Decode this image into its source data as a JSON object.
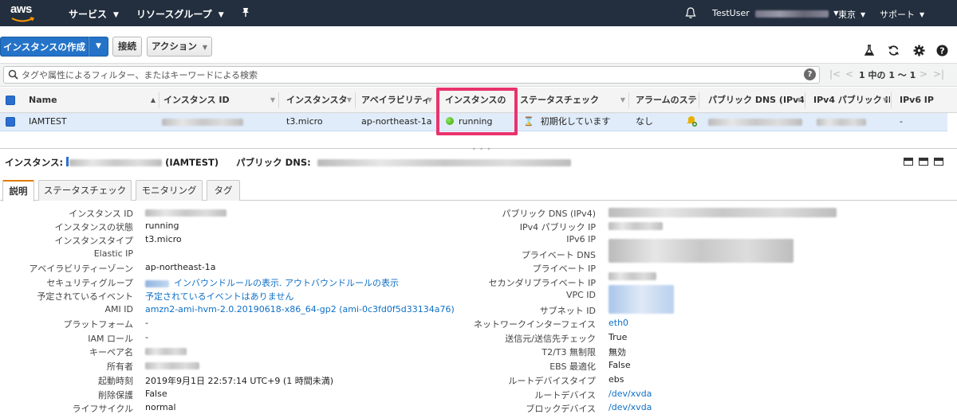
{
  "nav": {
    "logo": "aws",
    "services": "サービス",
    "resource_groups": "リソースグループ",
    "user": "TestUser",
    "region": "東京",
    "support": "サポート"
  },
  "toolbar": {
    "launch": "インスタンスの作成",
    "connect": "接続",
    "actions": "アクション"
  },
  "filter": {
    "placeholder": "タグや属性によるフィルター、またはキーワードによる検索",
    "pagination": "1 中の 1 〜 1"
  },
  "table": {
    "columns": [
      "Name",
      "インスタンス ID",
      "インスタンスタ",
      "アベイラビリティ",
      "インスタンスの",
      "ステータスチェック",
      "アラームのステ",
      "パブリック DNS (IPv4)",
      "IPv4 パブリック IP",
      "IPv6 IP"
    ],
    "row": {
      "name": "IAMTEST",
      "type": "t3.micro",
      "az": "ap-northeast-1a",
      "state": "running",
      "status_check": "初期化しています",
      "alarm": "なし",
      "ipv6": "-"
    },
    "state_color": "#3aa60c",
    "highlight_color": "#e8336d"
  },
  "detail": {
    "instance_label": "インスタンス:",
    "instance_name": "(IAMTEST)",
    "public_dns_label": "パブリック DNS:",
    "tabs": [
      "説明",
      "ステータスチェック",
      "モニタリング",
      "タグ"
    ],
    "left": [
      {
        "label": "インスタンス ID",
        "value": ""
      },
      {
        "label": "インスタンスの状態",
        "value": "running"
      },
      {
        "label": "インスタンスタイプ",
        "value": "t3.micro"
      },
      {
        "label": "Elastic IP",
        "value": ""
      },
      {
        "label": "アベイラビリティーゾーン",
        "value": "ap-northeast-1a"
      },
      {
        "label": "セキュリティグループ",
        "value": "インバウンドルールの表示. アウトバウンドルールの表示"
      },
      {
        "label": "予定されているイベント",
        "value": "予定されているイベントはありません"
      },
      {
        "label": "AMI ID",
        "value": "amzn2-ami-hvm-2.0.20190618-x86_64-gp2 (ami-0c3fd0f5d33134a76)"
      },
      {
        "label": "プラットフォーム",
        "value": "-"
      },
      {
        "label": "IAM ロール",
        "value": "-"
      },
      {
        "label": "キーペア名",
        "value": ""
      },
      {
        "label": "所有者",
        "value": ""
      },
      {
        "label": "起動時刻",
        "value": "2019年9月1日 22:57:14 UTC+9 (1 時間未満)"
      },
      {
        "label": "削除保護",
        "value": "False"
      },
      {
        "label": "ライフサイクル",
        "value": "normal"
      }
    ],
    "right": [
      {
        "label": "パブリック DNS (IPv4)",
        "value": ""
      },
      {
        "label": "IPv4 パブリック IP",
        "value": ""
      },
      {
        "label": "IPv6 IP",
        "value": ""
      },
      {
        "label": "プライベート DNS",
        "value": ""
      },
      {
        "label": "プライベート IP",
        "value": ""
      },
      {
        "label": "セカンダリプライベート IP",
        "value": ""
      },
      {
        "label": "VPC ID",
        "value": ""
      },
      {
        "label": "サブネット ID",
        "value": ""
      },
      {
        "label": "ネットワークインターフェイス",
        "value": "eth0"
      },
      {
        "label": "送信元/送信先チェック",
        "value": "True"
      },
      {
        "label": "T2/T3 無制限",
        "value": "無効"
      },
      {
        "label": "EBS 最適化",
        "value": "False"
      },
      {
        "label": "ルートデバイスタイプ",
        "value": "ebs"
      },
      {
        "label": "ルートデバイス",
        "value": "/dev/xvda"
      },
      {
        "label": "ブロックデバイス",
        "value": "/dev/xvda"
      }
    ]
  }
}
